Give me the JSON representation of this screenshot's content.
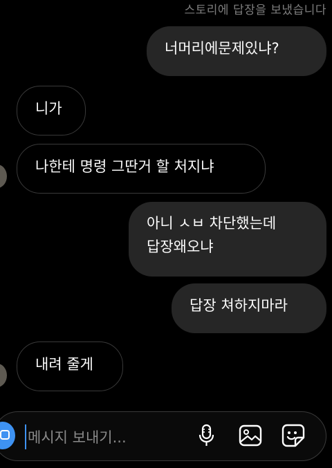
{
  "header": {
    "reply_note": "스토리에 답장을 보냈습니다"
  },
  "messages": [
    {
      "sender": "me",
      "text": "너머리에문제있냐?"
    },
    {
      "sender": "other",
      "text": "니가"
    },
    {
      "sender": "other",
      "text": "나한테 명령 그딴거 할 처지냐"
    },
    {
      "sender": "me",
      "text": "아니 ㅅㅂ 차단했는데\n답장왜오냐"
    },
    {
      "sender": "me",
      "text": "답장 쳐하지마라"
    },
    {
      "sender": "other",
      "text": "내려 줄게"
    }
  ],
  "composer": {
    "placeholder": "메시지 보내기...",
    "icons": [
      "camera-icon",
      "microphone-icon",
      "gallery-icon",
      "sticker-icon"
    ],
    "accent_color": "#3e92f2"
  }
}
